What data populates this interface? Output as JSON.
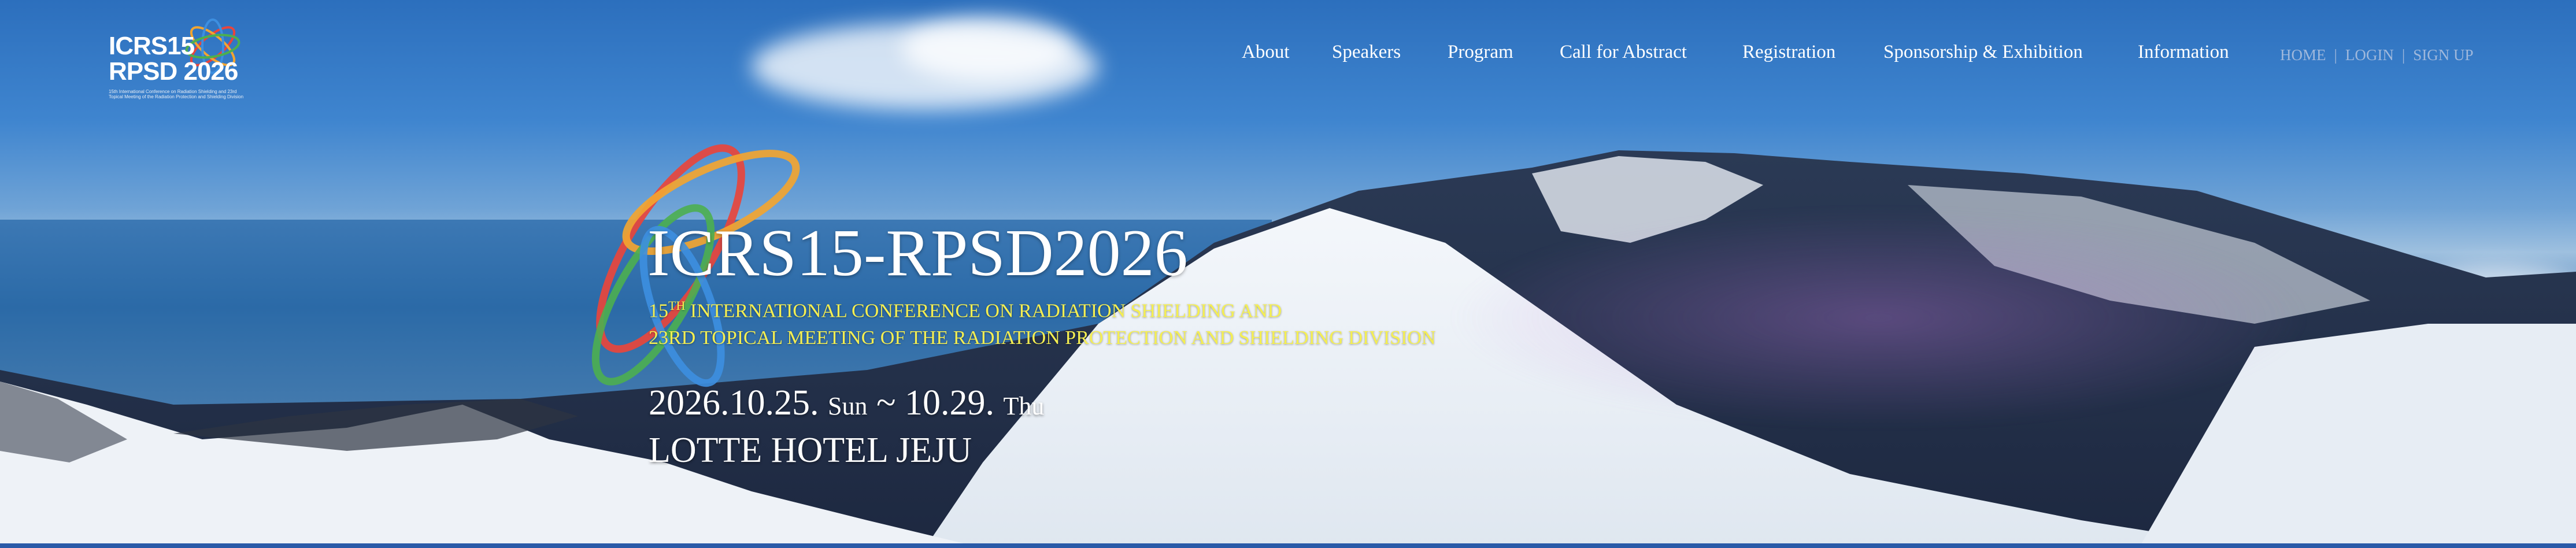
{
  "logo": {
    "line1": "ICRS15",
    "line2": "RPSD 2026",
    "fine_print": "15th International Conference on Radiation Shielding and 23rd Topical Meeting of the Radiation Protection and Shielding Division"
  },
  "nav": {
    "items": [
      {
        "label": "About"
      },
      {
        "label": "Speakers"
      },
      {
        "label": "Program"
      },
      {
        "label": "Call for Abstract"
      },
      {
        "label": "Registration"
      },
      {
        "label": "Sponsorship & Exhibition"
      },
      {
        "label": "Information"
      }
    ]
  },
  "utility": {
    "home": "HOME",
    "login": "LOGIN",
    "signup": "SIGN UP",
    "separator": "|"
  },
  "hero": {
    "title": "ICRS15-RPSD2026",
    "subtitle_line1_num": "15",
    "subtitle_line1_sup": "TH",
    "subtitle_line1_rest": " INTERNATIONAL CONFERENCE ON RADIATION SHIELDING AND",
    "subtitle_line2": "23RD TOPICAL MEETING OF THE RADIATION PROTECTION AND SHIELDING DIVISION",
    "date_start": "2026.10.25.",
    "date_start_dow": "Sun",
    "date_sep": "~",
    "date_end": "10.29.",
    "date_end_dow": "Thu",
    "venue": "LOTTE HOTEL JEJU"
  },
  "colors": {
    "subtitle": "#f5ef52",
    "orbit_red": "#e8453c",
    "orbit_orange": "#f2a531",
    "orbit_green": "#4caf50",
    "orbit_blue": "#3d8fe0",
    "utility_links": "#9fb8dc"
  }
}
